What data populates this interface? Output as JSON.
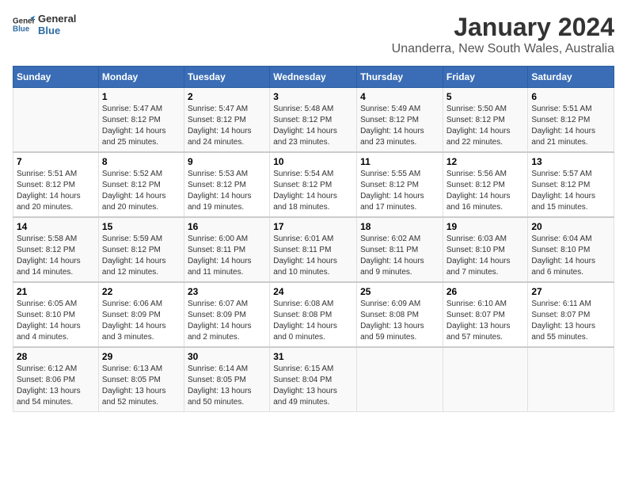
{
  "header": {
    "logo_line1": "General",
    "logo_line2": "Blue",
    "title": "January 2024",
    "subtitle": "Unanderra, New South Wales, Australia"
  },
  "days_of_week": [
    "Sunday",
    "Monday",
    "Tuesday",
    "Wednesday",
    "Thursday",
    "Friday",
    "Saturday"
  ],
  "weeks": [
    [
      {
        "day": "",
        "info": ""
      },
      {
        "day": "1",
        "info": "Sunrise: 5:47 AM\nSunset: 8:12 PM\nDaylight: 14 hours\nand 25 minutes."
      },
      {
        "day": "2",
        "info": "Sunrise: 5:47 AM\nSunset: 8:12 PM\nDaylight: 14 hours\nand 24 minutes."
      },
      {
        "day": "3",
        "info": "Sunrise: 5:48 AM\nSunset: 8:12 PM\nDaylight: 14 hours\nand 23 minutes."
      },
      {
        "day": "4",
        "info": "Sunrise: 5:49 AM\nSunset: 8:12 PM\nDaylight: 14 hours\nand 23 minutes."
      },
      {
        "day": "5",
        "info": "Sunrise: 5:50 AM\nSunset: 8:12 PM\nDaylight: 14 hours\nand 22 minutes."
      },
      {
        "day": "6",
        "info": "Sunrise: 5:51 AM\nSunset: 8:12 PM\nDaylight: 14 hours\nand 21 minutes."
      }
    ],
    [
      {
        "day": "7",
        "info": "Sunrise: 5:51 AM\nSunset: 8:12 PM\nDaylight: 14 hours\nand 20 minutes."
      },
      {
        "day": "8",
        "info": "Sunrise: 5:52 AM\nSunset: 8:12 PM\nDaylight: 14 hours\nand 20 minutes."
      },
      {
        "day": "9",
        "info": "Sunrise: 5:53 AM\nSunset: 8:12 PM\nDaylight: 14 hours\nand 19 minutes."
      },
      {
        "day": "10",
        "info": "Sunrise: 5:54 AM\nSunset: 8:12 PM\nDaylight: 14 hours\nand 18 minutes."
      },
      {
        "day": "11",
        "info": "Sunrise: 5:55 AM\nSunset: 8:12 PM\nDaylight: 14 hours\nand 17 minutes."
      },
      {
        "day": "12",
        "info": "Sunrise: 5:56 AM\nSunset: 8:12 PM\nDaylight: 14 hours\nand 16 minutes."
      },
      {
        "day": "13",
        "info": "Sunrise: 5:57 AM\nSunset: 8:12 PM\nDaylight: 14 hours\nand 15 minutes."
      }
    ],
    [
      {
        "day": "14",
        "info": "Sunrise: 5:58 AM\nSunset: 8:12 PM\nDaylight: 14 hours\nand 14 minutes."
      },
      {
        "day": "15",
        "info": "Sunrise: 5:59 AM\nSunset: 8:12 PM\nDaylight: 14 hours\nand 12 minutes."
      },
      {
        "day": "16",
        "info": "Sunrise: 6:00 AM\nSunset: 8:11 PM\nDaylight: 14 hours\nand 11 minutes."
      },
      {
        "day": "17",
        "info": "Sunrise: 6:01 AM\nSunset: 8:11 PM\nDaylight: 14 hours\nand 10 minutes."
      },
      {
        "day": "18",
        "info": "Sunrise: 6:02 AM\nSunset: 8:11 PM\nDaylight: 14 hours\nand 9 minutes."
      },
      {
        "day": "19",
        "info": "Sunrise: 6:03 AM\nSunset: 8:10 PM\nDaylight: 14 hours\nand 7 minutes."
      },
      {
        "day": "20",
        "info": "Sunrise: 6:04 AM\nSunset: 8:10 PM\nDaylight: 14 hours\nand 6 minutes."
      }
    ],
    [
      {
        "day": "21",
        "info": "Sunrise: 6:05 AM\nSunset: 8:10 PM\nDaylight: 14 hours\nand 4 minutes."
      },
      {
        "day": "22",
        "info": "Sunrise: 6:06 AM\nSunset: 8:09 PM\nDaylight: 14 hours\nand 3 minutes."
      },
      {
        "day": "23",
        "info": "Sunrise: 6:07 AM\nSunset: 8:09 PM\nDaylight: 14 hours\nand 2 minutes."
      },
      {
        "day": "24",
        "info": "Sunrise: 6:08 AM\nSunset: 8:08 PM\nDaylight: 14 hours\nand 0 minutes."
      },
      {
        "day": "25",
        "info": "Sunrise: 6:09 AM\nSunset: 8:08 PM\nDaylight: 13 hours\nand 59 minutes."
      },
      {
        "day": "26",
        "info": "Sunrise: 6:10 AM\nSunset: 8:07 PM\nDaylight: 13 hours\nand 57 minutes."
      },
      {
        "day": "27",
        "info": "Sunrise: 6:11 AM\nSunset: 8:07 PM\nDaylight: 13 hours\nand 55 minutes."
      }
    ],
    [
      {
        "day": "28",
        "info": "Sunrise: 6:12 AM\nSunset: 8:06 PM\nDaylight: 13 hours\nand 54 minutes."
      },
      {
        "day": "29",
        "info": "Sunrise: 6:13 AM\nSunset: 8:05 PM\nDaylight: 13 hours\nand 52 minutes."
      },
      {
        "day": "30",
        "info": "Sunrise: 6:14 AM\nSunset: 8:05 PM\nDaylight: 13 hours\nand 50 minutes."
      },
      {
        "day": "31",
        "info": "Sunrise: 6:15 AM\nSunset: 8:04 PM\nDaylight: 13 hours\nand 49 minutes."
      },
      {
        "day": "",
        "info": ""
      },
      {
        "day": "",
        "info": ""
      },
      {
        "day": "",
        "info": ""
      }
    ]
  ]
}
